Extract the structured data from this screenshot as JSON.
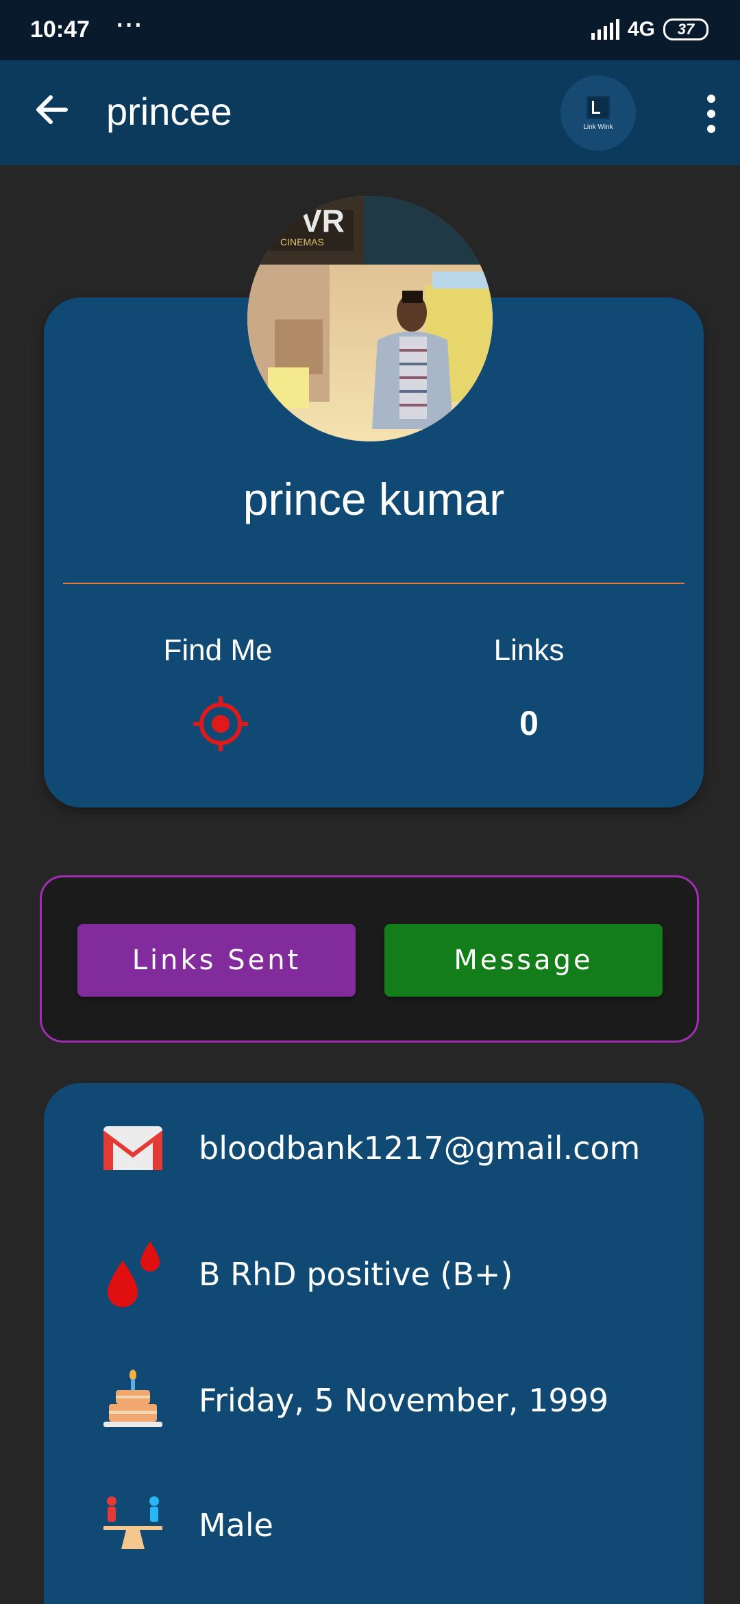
{
  "status_bar": {
    "time": "10:47",
    "dots": "···",
    "network": "4G",
    "battery": "37"
  },
  "app_bar": {
    "title": "princee",
    "logo_text": "Link Wink"
  },
  "profile": {
    "name": "prince kumar",
    "find_me_label": "Find Me",
    "links_label": "Links",
    "links_count": "0"
  },
  "actions": {
    "links_sent_label": "Links Sent",
    "message_label": "Message"
  },
  "info": {
    "email": "bloodbank1217@gmail.com",
    "blood_group": "B RhD positive (B+)",
    "dob": "Friday, 5 November, 1999",
    "gender": "Male"
  },
  "colors": {
    "app_bar": "#0c3a5c",
    "card": "#104a74",
    "divider": "#e07a36",
    "links_sent_button": "#812b9c",
    "message_button": "#137d1a",
    "action_box_border": "#a12eb2"
  },
  "icons": {
    "back": "arrow-left-icon",
    "more": "more-vert-icon",
    "find_me": "target-icon",
    "email": "gmail-icon",
    "blood": "blood-drop-icon",
    "dob": "birthday-cake-icon",
    "gender": "gender-seesaw-icon"
  }
}
